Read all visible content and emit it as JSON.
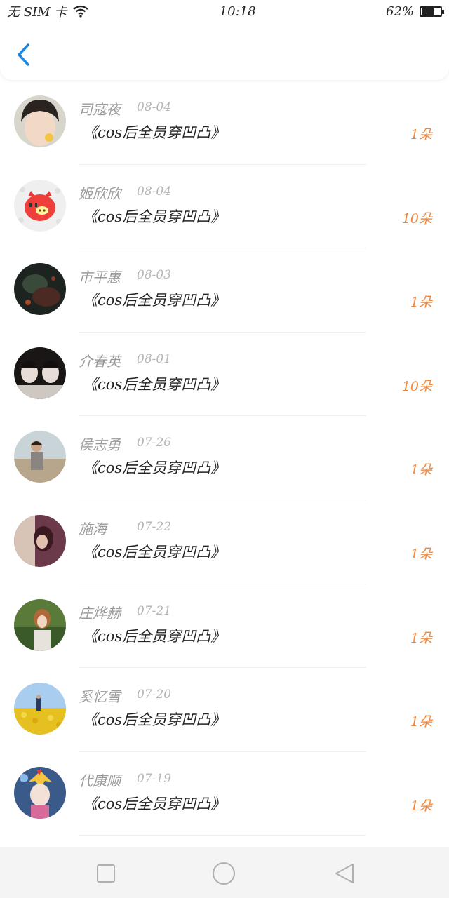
{
  "status_bar": {
    "carrier": "无 SIM 卡",
    "time": "10:18",
    "battery": "62%",
    "battery_level": 0.62
  },
  "header": {
    "back_icon": "chevron-left-icon",
    "accent": "#1e88e5"
  },
  "items": [
    {
      "name": "司寇夜",
      "date": "08-04",
      "title": "《cos后全员穿凹凸》",
      "count": "1朵",
      "avatar": "face-photo"
    },
    {
      "name": "姬欣欣",
      "date": "08-04",
      "title": "《cos后全员穿凹凸》",
      "count": "10朵",
      "avatar": "pig-avatar"
    },
    {
      "name": "市平惠",
      "date": "08-03",
      "title": "《cos后全员穿凹凸》",
      "count": "1朵",
      "avatar": "dark-photo"
    },
    {
      "name": "介春英",
      "date": "08-01",
      "title": "《cos后全员穿凹凸》",
      "count": "10朵",
      "avatar": "twins-photo"
    },
    {
      "name": "侯志勇",
      "date": "07-26",
      "title": "《cos后全员穿凹凸》",
      "count": "1朵",
      "avatar": "beach-photo"
    },
    {
      "name": "施海",
      "date": "07-22",
      "title": "《cos后全员穿凹凸》",
      "count": "1朵",
      "avatar": "purple-photo"
    },
    {
      "name": "庄烨赫",
      "date": "07-21",
      "title": "《cos后全员穿凹凸》",
      "count": "1朵",
      "avatar": "outdoor-photo"
    },
    {
      "name": "奚忆雪",
      "date": "07-20",
      "title": "《cos后全员穿凹凸》",
      "count": "1朵",
      "avatar": "flowers-photo"
    },
    {
      "name": "代康顺",
      "date": "07-19",
      "title": "《cos后全员穿凹凸》",
      "count": "1朵",
      "avatar": "anime-photo"
    }
  ],
  "colors": {
    "count": "#f0883e",
    "name": "#9a9a9a",
    "date": "#b5b5b5",
    "title": "#222222"
  },
  "nav": {
    "recent_icon": "square-icon",
    "home_icon": "circle-icon",
    "back_icon": "triangle-back-icon"
  }
}
